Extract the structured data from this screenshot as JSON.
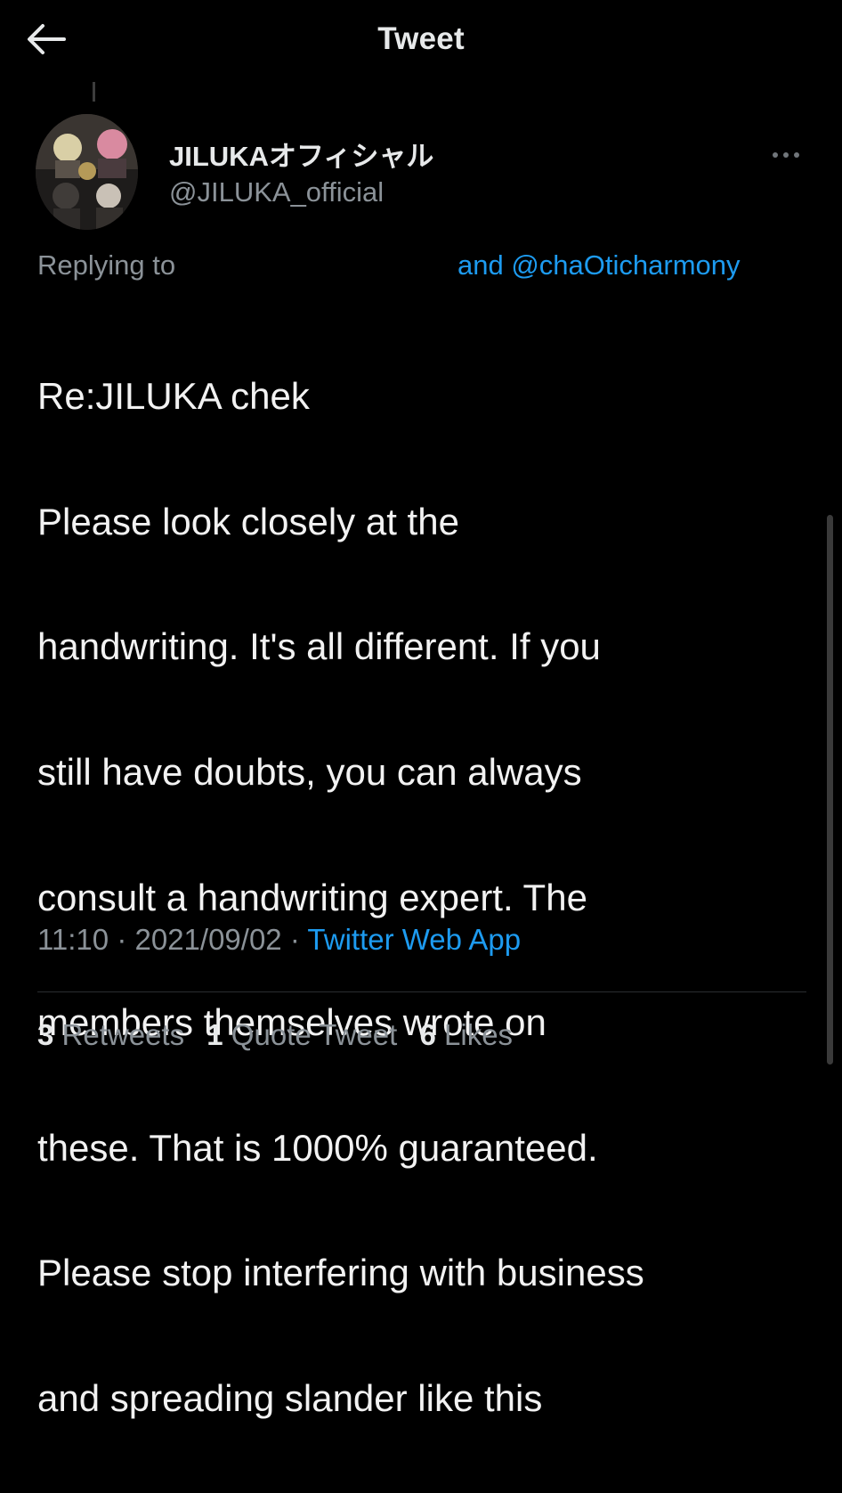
{
  "header": {
    "back_icon": "arrow-left-icon",
    "title": "Tweet"
  },
  "author": {
    "display_name": "JILUKAオフィシャル",
    "handle": "@JILUKA_official",
    "avatar_icon": "profile-avatar"
  },
  "more_icon": "more-horizontal-icon",
  "replying": {
    "label": "Replying to",
    "mention": "and @chaOticharmony"
  },
  "tweet": {
    "text_lines": [
      "Re:JILUKA chek",
      "Please look closely at the",
      "handwriting. It's all different. If you",
      "still have doubts, you can always",
      "consult a handwriting expert. The",
      "members themselves wrote on",
      "these. That is 1000% guaranteed.",
      "Please stop interfering with business",
      "and spreading slander like this"
    ]
  },
  "meta": {
    "time": "11:10",
    "date": "2021/09/02",
    "separator": "·",
    "source": "Twitter Web App"
  },
  "stats": {
    "retweets_count": "3",
    "retweets_label": "Retweets",
    "quotes_count": "1",
    "quotes_label": "Quote Tweet",
    "likes_count": "6",
    "likes_label": "Likes"
  },
  "colors": {
    "background": "#000000",
    "text": "#e7e9ea",
    "secondary": "#8b9298",
    "link": "#1d9bf0"
  }
}
